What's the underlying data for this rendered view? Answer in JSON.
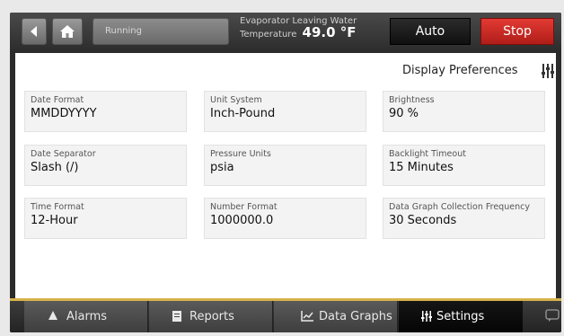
{
  "header": {
    "status": "Running",
    "evap_label_line1": "Evaporator Leaving Water",
    "evap_label_line2": "Temperature",
    "evap_value": "49.0 °F",
    "auto_label": "Auto",
    "stop_label": "Stop"
  },
  "main": {
    "title": "Display Preferences",
    "settings": [
      {
        "label": "Date Format",
        "value": "MMDDYYYY"
      },
      {
        "label": "Unit System",
        "value": "Inch-Pound"
      },
      {
        "label": "Brightness",
        "value": "90 %"
      },
      {
        "label": "Date Separator",
        "value": "Slash (/)"
      },
      {
        "label": "Pressure Units",
        "value": "psia"
      },
      {
        "label": "Backlight Timeout",
        "value": "15 Minutes"
      },
      {
        "label": "Time Format",
        "value": "12-Hour"
      },
      {
        "label": "Number Format",
        "value": "1000000.0"
      },
      {
        "label": "Data Graph Collection Frequency",
        "value": "30 Seconds"
      }
    ]
  },
  "nav": {
    "tabs": [
      {
        "label": "Alarms",
        "icon": "alarm-icon"
      },
      {
        "label": "Reports",
        "icon": "report-icon"
      },
      {
        "label": "Data Graphs",
        "icon": "graph-icon"
      },
      {
        "label": "Settings",
        "icon": "settings-icon",
        "active": true
      }
    ]
  },
  "colors": {
    "stop": "#c9271f",
    "accent_line": "#d7b24b",
    "active_tab": "#0a0a0a"
  }
}
